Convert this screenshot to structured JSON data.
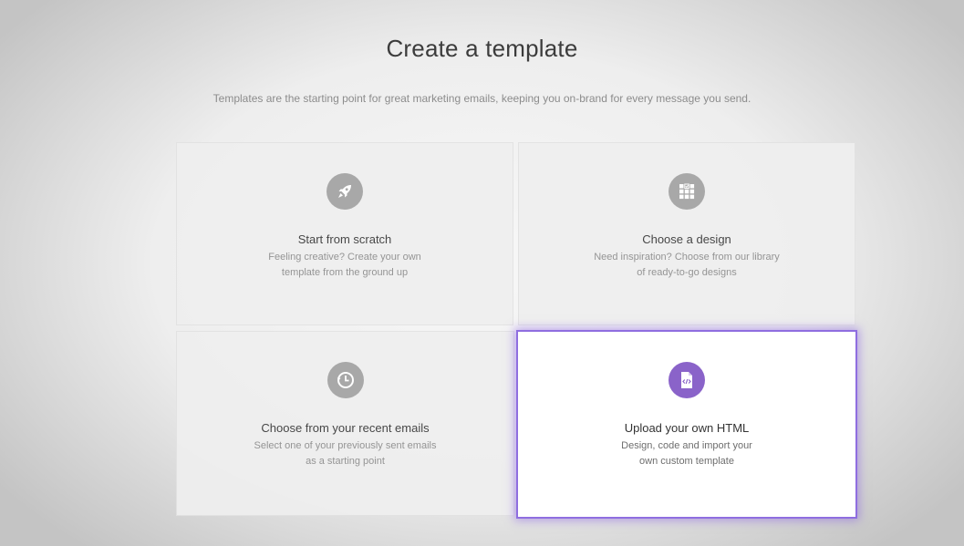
{
  "header": {
    "title": "Create a template",
    "subtitle": "Templates are the starting point for great marketing emails, keeping you on-brand for every message you send."
  },
  "cards": [
    {
      "icon": "rocket-icon",
      "title": "Start from scratch",
      "desc_line1": "Feeling creative? Create your own",
      "desc_line2": "template from the ground up"
    },
    {
      "icon": "design-grid-icon",
      "title": "Choose a design",
      "desc_line1": "Need inspiration? Choose from our library",
      "desc_line2": "of ready-to-go designs"
    },
    {
      "icon": "clock-history-icon",
      "title": "Choose from your recent emails",
      "desc_line1": "Select one of your previously sent emails",
      "desc_line2": "as a starting point"
    },
    {
      "icon": "code-file-icon",
      "title": "Upload your own HTML",
      "desc_line1": "Design, code and import your",
      "desc_line2": "own custom template",
      "highlighted": true
    }
  ],
  "colors": {
    "accent": "#8a63c9",
    "highlight_border": "#8f6ee0",
    "icon_gray": "#a3a3a3"
  }
}
